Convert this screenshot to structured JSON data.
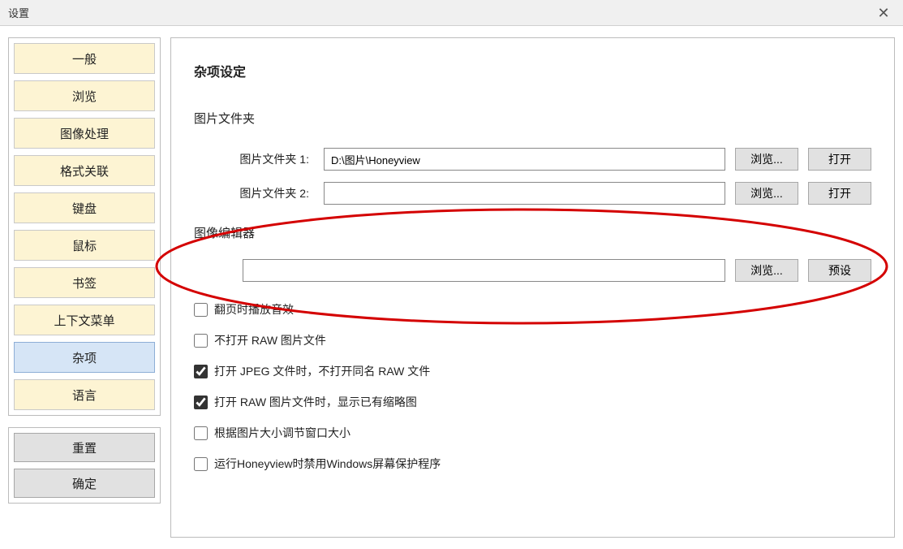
{
  "window": {
    "title": "设置",
    "close_glyph": "✕"
  },
  "sidebar": {
    "items": [
      {
        "label": "一般"
      },
      {
        "label": "浏览"
      },
      {
        "label": "图像处理"
      },
      {
        "label": "格式关联"
      },
      {
        "label": "键盘"
      },
      {
        "label": "鼠标"
      },
      {
        "label": "书签"
      },
      {
        "label": "上下文菜单"
      },
      {
        "label": "杂项"
      },
      {
        "label": "语言"
      }
    ],
    "selected": "杂项",
    "reset_label": "重置",
    "ok_label": "确定"
  },
  "content": {
    "section_title": "杂项设定",
    "image_folder": {
      "group_label": "图片文件夹",
      "folder1": {
        "label": "图片文件夹 1:",
        "value": "D:\\图片\\Honeyview"
      },
      "folder2": {
        "label": "图片文件夹 2:",
        "value": ""
      },
      "browse_label": "浏览...",
      "open_label": "打开"
    },
    "editor": {
      "group_label": "图像编辑器",
      "value": "",
      "browse_label": "浏览...",
      "preset_label": "预设"
    },
    "checks": {
      "c1": {
        "label": "翻页时播放音效",
        "checked": false
      },
      "c2": {
        "label": "不打开 RAW 图片文件",
        "checked": false
      },
      "c3": {
        "label": "打开 JPEG 文件时，不打开同名 RAW 文件",
        "checked": true
      },
      "c4": {
        "label": "打开 RAW 图片文件时，显示已有缩略图",
        "checked": true
      },
      "c5": {
        "label": "根据图片大小调节窗口大小",
        "checked": false
      },
      "c6": {
        "label": "运行Honeyview时禁用Windows屏幕保护程序",
        "checked": false
      }
    }
  }
}
